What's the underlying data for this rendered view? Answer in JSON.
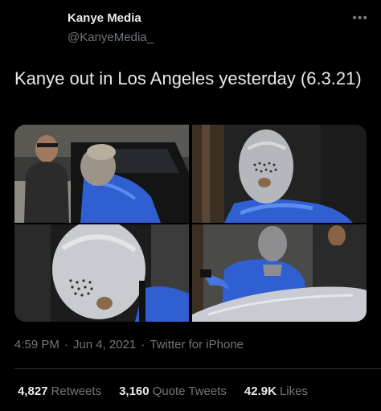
{
  "author": {
    "name": "Kanye Media",
    "handle": "@KanyeMedia_",
    "more_icon": "more-horizontal-icon"
  },
  "tweet": {
    "text": "Kanye out in Los Angeles yesterday (6.3.21)"
  },
  "meta": {
    "time": "4:59 PM",
    "date": "Jun 4, 2021",
    "source": "Twitter for iPhone",
    "separator": "·"
  },
  "stats": [
    {
      "num": "4,827",
      "label": "Retweets"
    },
    {
      "num": "3,160",
      "label": "Quote Tweets"
    },
    {
      "num": "42.9K",
      "label": "Likes"
    }
  ],
  "colors": {
    "background": "#000000",
    "primary_text": "#e7e9ea",
    "secondary_text": "#71767b",
    "divider": "#2f3336",
    "jacket_blue": "#2f5fd0"
  }
}
